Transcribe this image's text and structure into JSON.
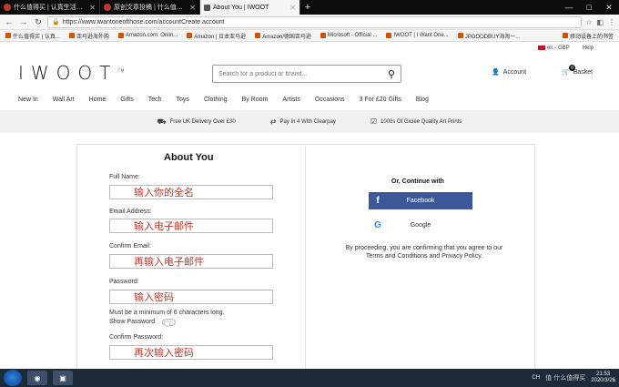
{
  "browser": {
    "tabs": [
      {
        "title": "什么值得买 | 认真生活，好好...",
        "active": false
      },
      {
        "title": "原创文章投稿 | 什么值得买",
        "active": false
      },
      {
        "title": "About You | IWOOT",
        "active": true
      }
    ],
    "url": "https://www.iwantoneofthose.com/accountCreate.account",
    "bookmarks": [
      "什么值得买 | 认真...",
      "亚马逊海外购",
      "Amazon.com: Onlin...",
      "Amazon | 日本亚马逊",
      "Amazon/德国亚马逊",
      "Microsoft - Official ...",
      "IWOOT | I Want One...",
      "JPGOODBUY海淘一...",
      "移动设备上的书签"
    ]
  },
  "site": {
    "locale": "en - GBP",
    "help": "Help",
    "logo": "IWOOT",
    "logo_tm": "TM",
    "search_placeholder": "Search for a product or brand...",
    "account": "Account",
    "basket": "Basket",
    "basket_count": "0",
    "nav": [
      "New In",
      "Wall Art",
      "Home",
      "Gifts",
      "Tech",
      "Toys",
      "Clothing",
      "By Room",
      "Artists",
      "Occasions",
      "3 For £20 Gifts",
      "Blog"
    ],
    "perks": [
      "Free UK Delivery Over £30",
      "Pay In 4 With Clearpay",
      "1000s Of Giclée Quality Art Prints"
    ]
  },
  "form": {
    "title": "About You",
    "full_name_label": "Full Name:",
    "full_name_value": "输入你的全名",
    "email_label": "Email Address:",
    "email_value": "输入电子邮件",
    "confirm_email_label": "Confirm Email:",
    "confirm_email_value": "再输入电子邮件",
    "password_label": "Password:",
    "password_value": "输入密码",
    "password_hint": "Must be a minimum of 6 characters long.",
    "show_password": "Show Password",
    "confirm_password_label": "Confirm Password:",
    "confirm_password_value": "再次输入密码"
  },
  "social": {
    "heading": "Or, Continue with",
    "facebook": "Facebook",
    "google": "Google",
    "terms": "By proceeding, you are confirming that you agree to our Terms and Conditions and Privacy Policy."
  },
  "taskbar": {
    "time": "21:53",
    "date": "2020/3/26",
    "watermark": "值 什么值得买",
    "lang": "CH"
  },
  "colors": {
    "facebook": "#3b5998",
    "annotation": "#c0392b",
    "taskbar": "#1c2a3a"
  }
}
